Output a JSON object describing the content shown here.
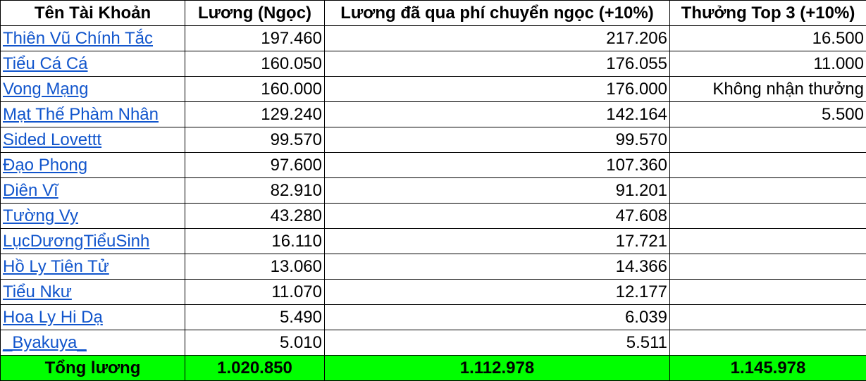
{
  "headers": [
    "Tên Tài Khoản",
    "Lương (Ngọc)",
    "Lương đã qua phí chuyển ngọc (+10%)",
    "Thưởng Top 3 (+10%)"
  ],
  "rows": [
    {
      "name": "Thiên Vũ Chính Tắc",
      "salary": "197.460",
      "after_fee": "217.206",
      "bonus": "16.500"
    },
    {
      "name": "Tiểu Cá Cá",
      "salary": "160.050",
      "after_fee": "176.055",
      "bonus": "11.000"
    },
    {
      "name": "Vong Mạng",
      "salary": "160.000",
      "after_fee": "176.000",
      "bonus": "Không nhận thưởng"
    },
    {
      "name": "Mạt Thế Phàm Nhân",
      "salary": "129.240",
      "after_fee": "142.164",
      "bonus": "5.500"
    },
    {
      "name": "Sided Lovettt",
      "salary": "99.570",
      "after_fee": "99.570",
      "bonus": ""
    },
    {
      "name": "Đạo Phong",
      "salary": "97.600",
      "after_fee": "107.360",
      "bonus": ""
    },
    {
      "name": "Diên Vĩ",
      "salary": "82.910",
      "after_fee": "91.201",
      "bonus": ""
    },
    {
      "name": "Tường Vy",
      "salary": "43.280",
      "after_fee": "47.608",
      "bonus": ""
    },
    {
      "name": "LụcDươngTiểuSinh",
      "salary": "16.110",
      "after_fee": "17.721",
      "bonus": ""
    },
    {
      "name": "Hồ Ly Tiên Tử",
      "salary": "13.060",
      "after_fee": "14.366",
      "bonus": ""
    },
    {
      "name": "Tiểu Nkư",
      "salary": "11.070",
      "after_fee": "12.177",
      "bonus": ""
    },
    {
      "name": "Hoa Ly Hi Dạ",
      "salary": "5.490",
      "after_fee": "6.039",
      "bonus": ""
    },
    {
      "name": "_Byakuya_",
      "salary": "5.010",
      "after_fee": "5.511",
      "bonus": ""
    }
  ],
  "total": {
    "label": "Tổng lương",
    "salary": "1.020.850",
    "after_fee": "1.112.978",
    "bonus": "1.145.978"
  },
  "colors": {
    "total_bg": "#00ff00",
    "link": "#1155cc",
    "border": "#000000"
  }
}
